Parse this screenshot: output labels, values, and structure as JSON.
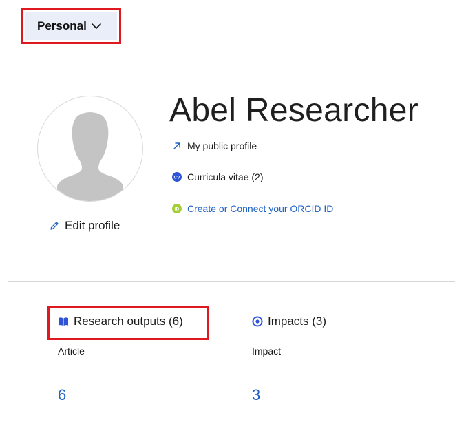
{
  "top_menu": {
    "label": "Personal",
    "icon": "chevron-down-icon"
  },
  "profile": {
    "name": "Abel Researcher",
    "edit_label": "Edit profile",
    "links": {
      "public_profile": "My public profile",
      "curricula_vitae": "Curricula vitae (2)",
      "orcid": "Create or Connect your ORCID ID"
    },
    "icons": {
      "public_profile": "arrow-up-right-icon",
      "curricula_vitae": "cv-badge-icon",
      "orcid": "orcid-icon",
      "edit": "pencil-icon",
      "avatar": "avatar-placeholder-icon"
    },
    "cv_badge_text": "CV",
    "orcid_badge_text": "iD"
  },
  "stats": {
    "research": {
      "title": "Research outputs (6)",
      "subtitle": "Article",
      "count": "6",
      "icon": "book-icon"
    },
    "impacts": {
      "title": "Impacts (3)",
      "subtitle": "Impact",
      "count": "3",
      "icon": "target-icon"
    }
  },
  "colors": {
    "highlight_border": "#e0181f",
    "menu_bg": "#e9eef9",
    "link_blue": "#2062c4",
    "cv_badge": "#2f54d8",
    "orcid_green": "#a6ce39",
    "avatar_gray": "#c4c4c4"
  }
}
